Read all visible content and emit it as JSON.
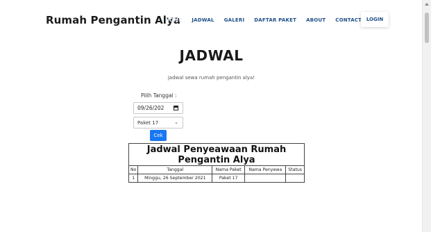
{
  "header": {
    "brand": "Rumah Pengantin Alya",
    "nav": [
      "HOME",
      "JADWAL",
      "GALERI",
      "DAFTAR PAKET",
      "ABOUT",
      "CONTACT"
    ],
    "login": "LOGIN"
  },
  "main": {
    "title": "JADWAL",
    "subtitle": "jadwal sewa rumah pengantin alya!",
    "date_label": "Pilih Tanggal :",
    "date_value": "09/26/202",
    "package_selected": "Paket 17",
    "check_button": "Cek"
  },
  "table": {
    "caption": "Jadwal Penyeawaan Rumah Pengantin Alya",
    "headers": [
      "No",
      "Tanggal",
      "Nama Paket",
      "Nama Penyewa",
      "Status"
    ],
    "rows": [
      [
        "1",
        "Minggu, 26 September 2021",
        "Paket 17",
        "",
        ""
      ]
    ]
  }
}
